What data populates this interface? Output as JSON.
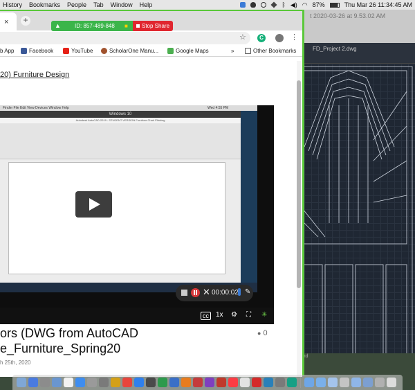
{
  "menubar": {
    "items": [
      "History",
      "Bookmarks",
      "People",
      "Tab",
      "Window",
      "Help"
    ],
    "battery": "87%",
    "clock": "Thu Mar 26  11:34:45 AM"
  },
  "autocad": {
    "title": "t 2020-03-26 at 9.53.02 AM",
    "file_tab": "FD_Project 2.dwg",
    "footer_text": "mond"
  },
  "chrome": {
    "tab_close": "×",
    "new_tab": "+",
    "star": "☆",
    "ext": "C",
    "menu": "⋮"
  },
  "zoom": {
    "meeting_id": "ID: 857-489-848",
    "stop_share": "Stop Share"
  },
  "bookmarks": {
    "items": [
      {
        "label": "b App",
        "icon_color": "#ffffff"
      },
      {
        "label": "Facebook",
        "icon_color": "#3b5998"
      },
      {
        "label": "YouTube",
        "icon_color": "#e62117"
      },
      {
        "label": "ScholarOne Manu...",
        "icon_color": "#a0522d"
      },
      {
        "label": "Google Maps",
        "icon_color": "#4caf50"
      }
    ],
    "more": "»",
    "other": "Other Bookmarks"
  },
  "page": {
    "breadcrumb": "20) Furniture Design",
    "video": {
      "mac_bar": "Finder  File  Edit  View  Devices  Window  Help",
      "mac_time": "Wed 4:55 PM",
      "win_title": "Windows 10",
      "app_title": "Autodesk AutoCAD 2019 - STUDENT VERSION    Furniture Chair Pltndwg",
      "recording_time": "00:00:02",
      "speed": "1x"
    },
    "post_title": "ors (DWG from AutoCAD e_Furniture_Spring20",
    "comments": "0",
    "date": "h 25th, 2020"
  },
  "dock": {
    "apps": [
      "#7fa7d6",
      "#4a7be0",
      "#8c8c8c",
      "#6a96d0",
      "#f2f2f2",
      "#3e8df0",
      "#9a9a9a",
      "#7a7a7a",
      "#d4a017",
      "#e8453c",
      "#2f80ed",
      "#4a4a4a",
      "#2d9a4c",
      "#3a6fc7",
      "#e87c1e",
      "#c43b3b",
      "#7f3fbf",
      "#c0392b",
      "#fc3c44",
      "#e3e3e3",
      "#d52a2a",
      "#2980b9",
      "#7a7a7a",
      "#16a085"
    ],
    "folders": [
      "#6ea6e6",
      "#7ab0ea",
      "#a4c4ec",
      "#c4c4c4",
      "#8fb6e8",
      "#7c9fd0",
      "#b0b0b0"
    ],
    "trash": "#dcdcdc"
  }
}
